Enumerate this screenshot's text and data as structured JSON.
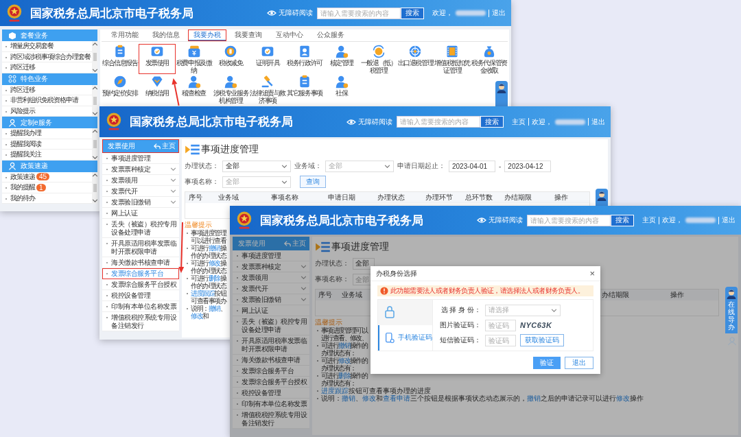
{
  "portal_window": {
    "header": {
      "title": "国家税务总局北京市电子税务局",
      "accessibility": "无障碍阅读",
      "search_placeholder": "请输入需要搜索的内容",
      "search_button": "搜索",
      "welcome": "欢迎，",
      "logout": "退出"
    },
    "sidebar": [
      {
        "title": "套餐业务",
        "items": [
          {
            "label": "增量房交易套餐"
          },
          {
            "label": "跨区域涉税事项综合办理套餐"
          },
          {
            "label": "跨区迁移"
          }
        ]
      },
      {
        "title": "特色业务",
        "items": [
          {
            "label": "跨区迁移"
          },
          {
            "label": "非营利组织免税资格申请"
          },
          {
            "label": "风险提示"
          }
        ]
      },
      {
        "title": "定制e服务",
        "items": [
          {
            "label": "提醒我办理"
          },
          {
            "label": "提醒我阅读"
          },
          {
            "label": "提醒我关注"
          }
        ]
      },
      {
        "title": "政策速递",
        "items": [
          {
            "label": "政策速递",
            "badge": "45"
          },
          {
            "label": "我的提醒",
            "badge": "1"
          },
          {
            "label": "我的待办"
          }
        ]
      }
    ],
    "tabs": [
      {
        "label": "常用功能",
        "selected": false,
        "highlighted": false
      },
      {
        "label": "我的信息",
        "selected": false,
        "highlighted": false
      },
      {
        "label": "我要办税",
        "selected": true,
        "highlighted": true
      },
      {
        "label": "我要查询",
        "selected": false,
        "highlighted": false
      },
      {
        "label": "互动中心",
        "selected": false,
        "highlighted": false
      },
      {
        "label": "公众服务",
        "selected": false,
        "highlighted": false
      }
    ],
    "services": [
      {
        "label": "综合信息报告",
        "highlighted": false
      },
      {
        "label": "发票使用",
        "highlighted": true
      },
      {
        "label": "税费申报及缴纳",
        "highlighted": false
      },
      {
        "label": "税收减免",
        "highlighted": false
      },
      {
        "label": "证明开具",
        "highlighted": false
      },
      {
        "label": "税务行政许可",
        "highlighted": false
      },
      {
        "label": "核定管理",
        "highlighted": false
      },
      {
        "label": "一般退（抵）税管理",
        "highlighted": false
      },
      {
        "label": "出口退税管理",
        "highlighted": false
      },
      {
        "label": "增值税抵扣凭证管理",
        "highlighted": false
      },
      {
        "label": "税务代保管资金收取",
        "highlighted": false
      },
      {
        "label": "预约定价安排",
        "highlighted": false
      },
      {
        "label": "纳税信用",
        "highlighted": false
      },
      {
        "label": "稽查检查",
        "highlighted": false
      },
      {
        "label": "涉税专业服务机构管理",
        "highlighted": false
      },
      {
        "label": "法律追责与救济事项",
        "highlighted": false
      },
      {
        "label": "其它服务事项",
        "highlighted": false
      },
      {
        "label": "社保",
        "highlighted": false
      }
    ]
  },
  "invoice_window": {
    "header": {
      "title": "国家税务总局北京市电子税务局",
      "accessibility": "无障碍阅读",
      "search_placeholder": "请输入需要搜索的内容",
      "search_button": "搜索",
      "home": "主页",
      "welcome": "欢迎，",
      "logout": "退出"
    },
    "sidebar": {
      "title": "发票使用",
      "home": "主页",
      "highlighted": true,
      "items": [
        {
          "label": "事项进度管理",
          "expandable": false,
          "selected": false,
          "highlighted": false
        },
        {
          "label": "发票票种核定",
          "expandable": true,
          "selected": false,
          "highlighted": false
        },
        {
          "label": "发票领用",
          "expandable": true,
          "selected": false,
          "highlighted": false
        },
        {
          "label": "发票代开",
          "expandable": true,
          "selected": false,
          "highlighted": false
        },
        {
          "label": "发票验旧缴销",
          "expandable": true,
          "selected": false,
          "highlighted": false
        },
        {
          "label": "网上认证",
          "expandable": false,
          "selected": false,
          "highlighted": false
        },
        {
          "label": "丢失（被盗）税控专用设备处理申请",
          "expandable": false,
          "selected": false,
          "highlighted": false
        },
        {
          "label": "开具原适用税率发票临时开票权限申请",
          "expandable": false,
          "selected": false,
          "highlighted": false
        },
        {
          "label": "海关缴款书核查申请",
          "expandable": false,
          "selected": false,
          "highlighted": false
        },
        {
          "label": "发票综合服务平台",
          "expandable": false,
          "selected": true,
          "highlighted": true
        },
        {
          "label": "发票综合服务平台授权",
          "expandable": false,
          "selected": false,
          "highlighted": false
        },
        {
          "label": "税控设备管理",
          "expandable": false,
          "selected": false,
          "highlighted": false
        },
        {
          "label": "印制有本单位名称发票",
          "expandable": false,
          "selected": false,
          "highlighted": false
        },
        {
          "label": "增值税税控系统专用设备注销发行",
          "expandable": false,
          "selected": false,
          "highlighted": false
        }
      ]
    },
    "page_title": "事项进度管理",
    "filter_rows": [
      [
        {
          "kind": "select",
          "label": "办理状态：",
          "value": "全部"
        },
        {
          "kind": "select",
          "label": "业务域：",
          "placeholder": "全部"
        },
        {
          "kind": "date_range",
          "label": "申请日期起止：",
          "from": "2023-04-01",
          "separator": "-",
          "to": "2023-04-12"
        }
      ],
      [
        {
          "kind": "select",
          "label": "事项名称：",
          "placeholder": "全部"
        },
        {
          "kind": "button",
          "label": "查询"
        }
      ]
    ],
    "table": {
      "columns": [
        {
          "label": "序号"
        },
        {
          "label": "业务域"
        },
        {
          "label": "事项名称"
        },
        {
          "label": "申请日期"
        },
        {
          "label": "办理状态"
        },
        {
          "label": "办理环节"
        },
        {
          "label": "总环节数"
        },
        {
          "label": "办结期限"
        },
        {
          "label": "操作"
        }
      ]
    },
    "tips": {
      "title": "温馨提示",
      "lines": [
        [
          {
            "text": "事项进度管理可以进行查看",
            "link": false
          }
        ],
        [
          {
            "text": "可进行",
            "link": false
          },
          {
            "text": "撤销",
            "link": true
          },
          {
            "text": "操作的办理状态",
            "link": false
          }
        ],
        [
          {
            "text": "可进行",
            "link": false
          },
          {
            "text": "修改",
            "link": true
          },
          {
            "text": "操作的办理状态",
            "link": false
          }
        ],
        [
          {
            "text": "可进行",
            "link": false
          },
          {
            "text": "删除",
            "link": true
          },
          {
            "text": "操作的办理状态",
            "link": false
          }
        ],
        [
          {
            "text": "进度跟踪",
            "link": true
          },
          {
            "text": "按钮可查看事项办",
            "link": false
          }
        ],
        [
          {
            "text": "说明：",
            "link": false
          },
          {
            "text": "撤销",
            "link": true
          },
          {
            "text": "、",
            "link": false
          },
          {
            "text": "修改",
            "link": true
          },
          {
            "text": "和",
            "link": false
          }
        ]
      ]
    }
  },
  "dialog_window": {
    "header": {
      "title": "国家税务总局北京市电子税务局",
      "accessibility": "无障碍阅读",
      "search_placeholder": "请输入需要搜索的内容",
      "search_button": "搜索",
      "home": "主页",
      "welcome": "欢迎，",
      "logout": "退出"
    },
    "sidebar": {
      "title": "发票使用",
      "home": "主页",
      "highlighted": false,
      "items": [
        {
          "label": "事项进度管理",
          "expandable": false,
          "selected": false,
          "highlighted": false
        },
        {
          "label": "发票票种核定",
          "expandable": true,
          "selected": false,
          "highlighted": false
        },
        {
          "label": "发票领用",
          "expandable": true,
          "selected": false,
          "highlighted": false
        },
        {
          "label": "发票代开",
          "expandable": true,
          "selected": false,
          "highlighted": false
        },
        {
          "label": "发票验旧缴销",
          "expandable": true,
          "selected": false,
          "highlighted": false
        },
        {
          "label": "网上认证",
          "expandable": false,
          "selected": false,
          "highlighted": false
        },
        {
          "label": "丢失（被盗）税控专用设备处理申请",
          "expandable": false,
          "selected": false,
          "highlighted": false
        },
        {
          "label": "开具原适用税率发票临时开票权限申请",
          "expandable": false,
          "selected": false,
          "highlighted": false
        },
        {
          "label": "海关缴款书核查申请",
          "expandable": false,
          "selected": false,
          "highlighted": false
        },
        {
          "label": "发票综合服务平台",
          "expandable": false,
          "selected": false,
          "highlighted": false
        },
        {
          "label": "发票综合服务平台授权",
          "expandable": false,
          "selected": false,
          "highlighted": false
        },
        {
          "label": "税控设备管理",
          "expandable": false,
          "selected": false,
          "highlighted": false
        },
        {
          "label": "印制有本单位名称发票",
          "expandable": false,
          "selected": false,
          "highlighted": false
        },
        {
          "label": "增值税税控系统专用设备注销发行",
          "expandable": false,
          "selected": false,
          "highlighted": false
        }
      ]
    },
    "page_title": "事项进度管理",
    "filter_rows": [
      [
        {
          "kind": "field",
          "label": "办理状态：",
          "value": "全部"
        }
      ],
      [
        {
          "kind": "field",
          "label": "事项名称：",
          "placeholder": "全部"
        }
      ]
    ],
    "table": {
      "columns": [
        {
          "label": "序号"
        },
        {
          "label": "业务域"
        },
        {
          "label": "办结期限"
        },
        {
          "label": "操作"
        }
      ]
    },
    "tips": {
      "title": "温馨提示",
      "lines": [
        [
          {
            "text": "事项进度管理可以进行查看、修改、",
            "link": false
          }
        ],
        [
          {
            "text": "可进行",
            "link": false
          },
          {
            "text": "撤销",
            "link": true
          },
          {
            "text": "操作的办理状态有：",
            "link": false
          }
        ],
        [
          {
            "text": "可进行",
            "link": false
          },
          {
            "text": "修改",
            "link": true
          },
          {
            "text": "操作的办理状态有：",
            "link": false
          }
        ],
        [
          {
            "text": "可进行",
            "link": false
          },
          {
            "text": "删除",
            "link": true
          },
          {
            "text": "操作的办理状态有：",
            "link": false
          }
        ],
        [
          {
            "text": "进度跟踪",
            "link": true
          },
          {
            "text": "按钮可查看事项办理的进度",
            "link": false
          }
        ],
        [
          {
            "text": "说明：",
            "link": false
          },
          {
            "text": "撤销",
            "link": true
          },
          {
            "text": "、",
            "link": false
          },
          {
            "text": "修改",
            "link": true
          },
          {
            "text": "和",
            "link": false
          },
          {
            "text": "查看申请",
            "link": true
          },
          {
            "text": "三个按钮是根据事项状态动态展示的，",
            "link": false
          },
          {
            "text": "撤销",
            "link": true
          },
          {
            "text": "之后的申请记录可以进行",
            "link": false
          },
          {
            "text": "修改",
            "link": true
          },
          {
            "text": "操作",
            "link": false
          }
        ]
      ]
    },
    "help_widget": {
      "label": "在线导办"
    },
    "dialog": {
      "title": "办税身份选择",
      "close": "×",
      "warning": "此功能需要法人或者财务负责人验证，请选择法人或者财务负责人。",
      "methods": [
        {
          "kind": "lock",
          "selected": false
        },
        {
          "kind": "phone",
          "label": "手机验证码",
          "selected": true
        }
      ],
      "fields": [
        {
          "kind": "select",
          "label": "选 择 身 份：",
          "placeholder": "请选择"
        },
        {
          "kind": "captcha",
          "label": "图片验证码：",
          "placeholder": "验证码",
          "captcha": "NYC63K"
        },
        {
          "kind": "sms",
          "label": "短信验证码：",
          "placeholder": "验证码",
          "button": "获取验证码"
        }
      ],
      "buttons": [
        {
          "label": "验证",
          "primary": true
        },
        {
          "label": "退出",
          "primary": false
        }
      ]
    }
  }
}
